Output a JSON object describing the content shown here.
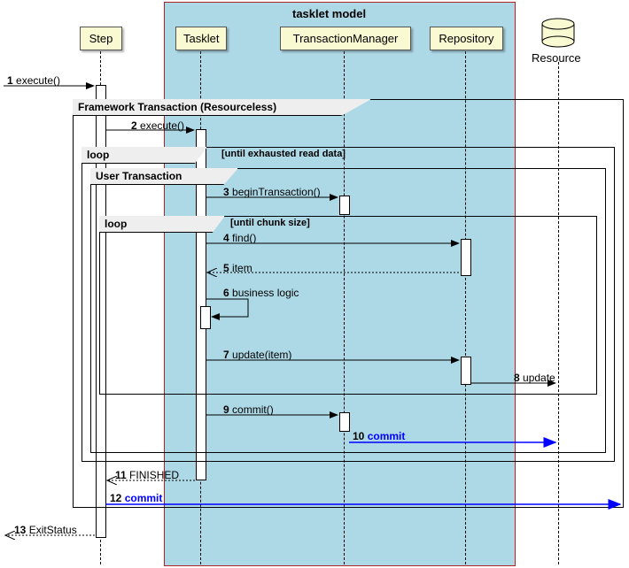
{
  "box": {
    "title": "tasklet model"
  },
  "participants": {
    "step": "Step",
    "tasklet": "Tasklet",
    "txmgr": "TransactionManager",
    "repo": "Repository",
    "resource": "Resource"
  },
  "frames": {
    "outer": "Framework Transaction (Resourceless)",
    "loop1": "loop",
    "loop1_cond": "[until exhausted read data]",
    "inner": "User Transaction",
    "loop2": "loop",
    "loop2_cond": "[until chunk size]"
  },
  "messages": {
    "m1": {
      "n": "1",
      "t": "execute()"
    },
    "m2": {
      "n": "2",
      "t": "execute()"
    },
    "m3": {
      "n": "3",
      "t": "beginTransaction()"
    },
    "m4": {
      "n": "4",
      "t": "find()"
    },
    "m5": {
      "n": "5",
      "t": "item"
    },
    "m6": {
      "n": "6",
      "t": "business logic"
    },
    "m7": {
      "n": "7",
      "t": "update(item)"
    },
    "m8": {
      "n": "8",
      "t": "update"
    },
    "m9": {
      "n": "9",
      "t": "commit()"
    },
    "m10": {
      "n": "10",
      "t": "commit"
    },
    "m11": {
      "n": "11",
      "t": "FINISHED"
    },
    "m12": {
      "n": "12",
      "t": "commit"
    },
    "m13": {
      "n": "13",
      "t": "ExitStatus"
    }
  },
  "chart_data": {
    "type": "sequence-diagram",
    "box": {
      "name": "tasklet model",
      "participants": [
        "Tasklet",
        "TransactionManager",
        "Repository"
      ]
    },
    "participants": [
      "Step",
      "Tasklet",
      "TransactionManager",
      "Repository",
      "Resource"
    ],
    "external_actor": "caller",
    "resource_is_database": true,
    "frames": [
      {
        "kind": "group",
        "label": "Framework Transaction (Resourceless)",
        "children": [
          {
            "kind": "loop",
            "label": "until exhausted read data",
            "children": [
              {
                "kind": "group",
                "label": "User Transaction",
                "children": [
                  {
                    "kind": "loop",
                    "label": "until chunk size"
                  }
                ]
              }
            ]
          }
        ]
      }
    ],
    "messages": [
      {
        "seq": 1,
        "from": "caller",
        "to": "Step",
        "label": "execute()",
        "type": "sync"
      },
      {
        "seq": 2,
        "from": "Step",
        "to": "Tasklet",
        "label": "execute()",
        "type": "sync",
        "frame": "Framework Transaction (Resourceless)"
      },
      {
        "seq": 3,
        "from": "Tasklet",
        "to": "TransactionManager",
        "label": "beginTransaction()",
        "type": "sync",
        "frame": "User Transaction"
      },
      {
        "seq": 4,
        "from": "Tasklet",
        "to": "Repository",
        "label": "find()",
        "type": "sync",
        "frame": "loop until chunk size"
      },
      {
        "seq": 5,
        "from": "Repository",
        "to": "Tasklet",
        "label": "item",
        "type": "return",
        "frame": "loop until chunk size"
      },
      {
        "seq": 6,
        "from": "Tasklet",
        "to": "Tasklet",
        "label": "business logic",
        "type": "self",
        "frame": "loop until chunk size"
      },
      {
        "seq": 7,
        "from": "Tasklet",
        "to": "Repository",
        "label": "update(item)",
        "type": "sync",
        "frame": "loop until chunk size"
      },
      {
        "seq": 8,
        "from": "Repository",
        "to": "Resource",
        "label": "update",
        "type": "sync",
        "frame": "loop until chunk size"
      },
      {
        "seq": 9,
        "from": "Tasklet",
        "to": "TransactionManager",
        "label": "commit()",
        "type": "sync",
        "frame": "User Transaction"
      },
      {
        "seq": 10,
        "from": "TransactionManager",
        "to": "Resource",
        "label": "commit",
        "type": "sync",
        "blue": true,
        "frame": "User Transaction"
      },
      {
        "seq": 11,
        "from": "Tasklet",
        "to": "Step",
        "label": "FINISHED",
        "type": "return",
        "frame": "Framework Transaction (Resourceless)"
      },
      {
        "seq": 12,
        "from": "Step",
        "to": "Resource",
        "label": "commit",
        "type": "sync",
        "blue": true,
        "frame": "Framework Transaction (Resourceless)"
      },
      {
        "seq": 13,
        "from": "Step",
        "to": "caller",
        "label": "ExitStatus",
        "type": "return"
      }
    ]
  }
}
